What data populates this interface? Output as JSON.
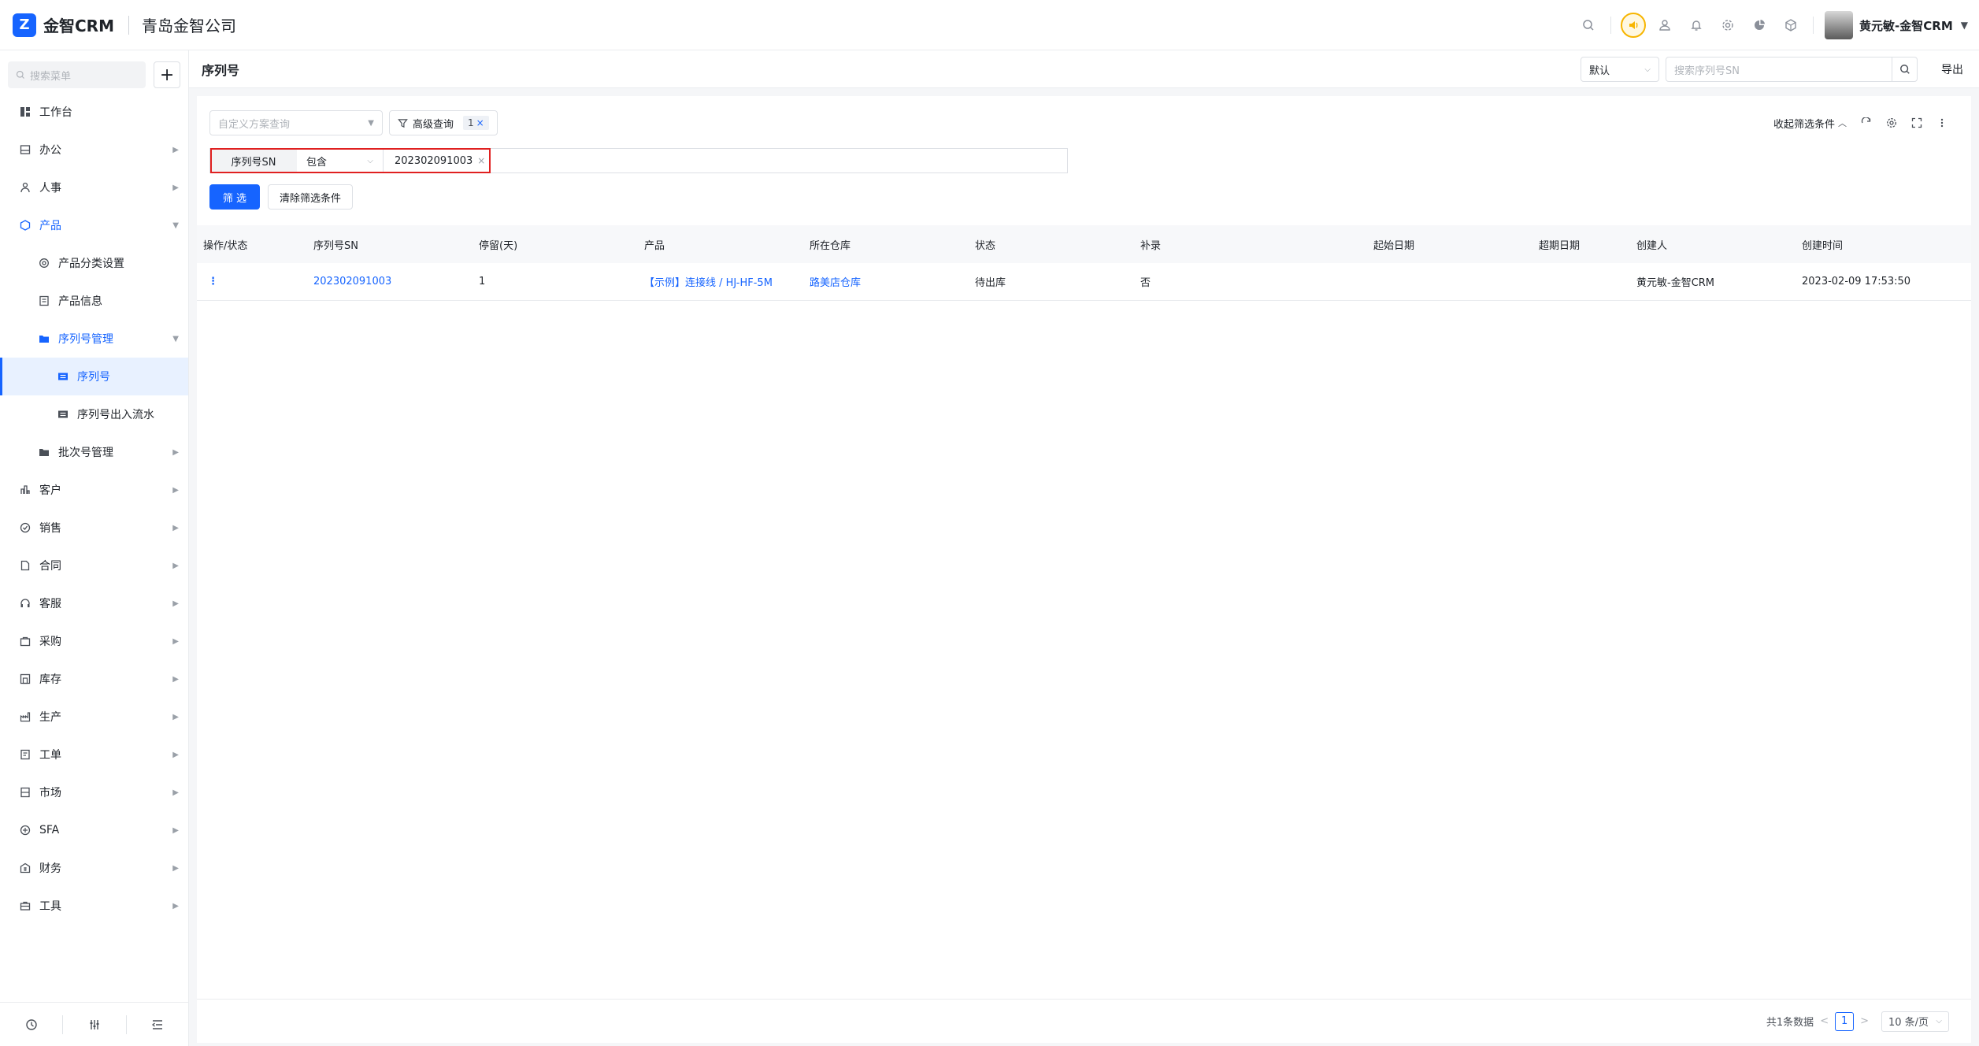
{
  "app": {
    "brand": "金智CRM",
    "company": "青岛金智公司"
  },
  "user": {
    "name": "黄元敏-金智CRM"
  },
  "sidebar": {
    "search_placeholder": "搜索菜单",
    "items": [
      {
        "label": "工作台",
        "icon": "dashboard-icon"
      },
      {
        "label": "办公",
        "icon": "office-icon"
      },
      {
        "label": "人事",
        "icon": "people-icon"
      },
      {
        "label": "产品",
        "icon": "product-icon"
      },
      {
        "label": "产品分类设置",
        "icon": "settings-icon"
      },
      {
        "label": "产品信息",
        "icon": "doc-icon"
      },
      {
        "label": "序列号管理",
        "icon": "folder-icon"
      },
      {
        "label": "序列号",
        "icon": "serial-icon"
      },
      {
        "label": "序列号出入流水",
        "icon": "flow-icon"
      },
      {
        "label": "批次号管理",
        "icon": "folder-icon"
      },
      {
        "label": "客户",
        "icon": "customer-icon"
      },
      {
        "label": "销售",
        "icon": "sales-icon"
      },
      {
        "label": "合同",
        "icon": "contract-icon"
      },
      {
        "label": "客服",
        "icon": "service-icon"
      },
      {
        "label": "采购",
        "icon": "purchase-icon"
      },
      {
        "label": "库存",
        "icon": "inventory-icon"
      },
      {
        "label": "生产",
        "icon": "production-icon"
      },
      {
        "label": "工单",
        "icon": "workorder-icon"
      },
      {
        "label": "市场",
        "icon": "market-icon"
      },
      {
        "label": "SFA",
        "icon": "sfa-icon"
      },
      {
        "label": "财务",
        "icon": "finance-icon"
      },
      {
        "label": "工具",
        "icon": "tools-icon"
      }
    ]
  },
  "header": {
    "title": "序列号",
    "view_select": "默认",
    "search_placeholder": "搜索序列号SN",
    "export_label": "导出"
  },
  "filters": {
    "scheme_placeholder": "自定义方案查询",
    "advanced_label": "高级查询",
    "advanced_count": "1",
    "collapse_label": "收起筛选条件",
    "condition": {
      "field": "序列号SN",
      "operator": "包含",
      "value": "202302091003"
    },
    "filter_button": "筛 选",
    "clear_button": "清除筛选条件"
  },
  "table": {
    "columns": [
      "操作/状态",
      "序列号SN",
      "停留(天)",
      "产品",
      "所在仓库",
      "状态",
      "补录",
      "起始日期",
      "超期日期",
      "创建人",
      "创建时间"
    ],
    "rows": [
      {
        "action": "⋮",
        "sn": "202302091003",
        "stay_days": "1",
        "product": "【示例】连接线 / HJ-HF-5M",
        "warehouse": "路美店仓库",
        "status": "待出库",
        "supplement": "否",
        "start_date": "",
        "expire_date": "",
        "creator": "黄元敏-金智CRM",
        "created_at": "2023-02-09 17:53:50"
      }
    ]
  },
  "pagination": {
    "total_text": "共1条数据",
    "current_page": "1",
    "page_size": "10 条/页"
  },
  "colors": {
    "primary": "#1664ff",
    "highlight_border": "#e02020"
  }
}
